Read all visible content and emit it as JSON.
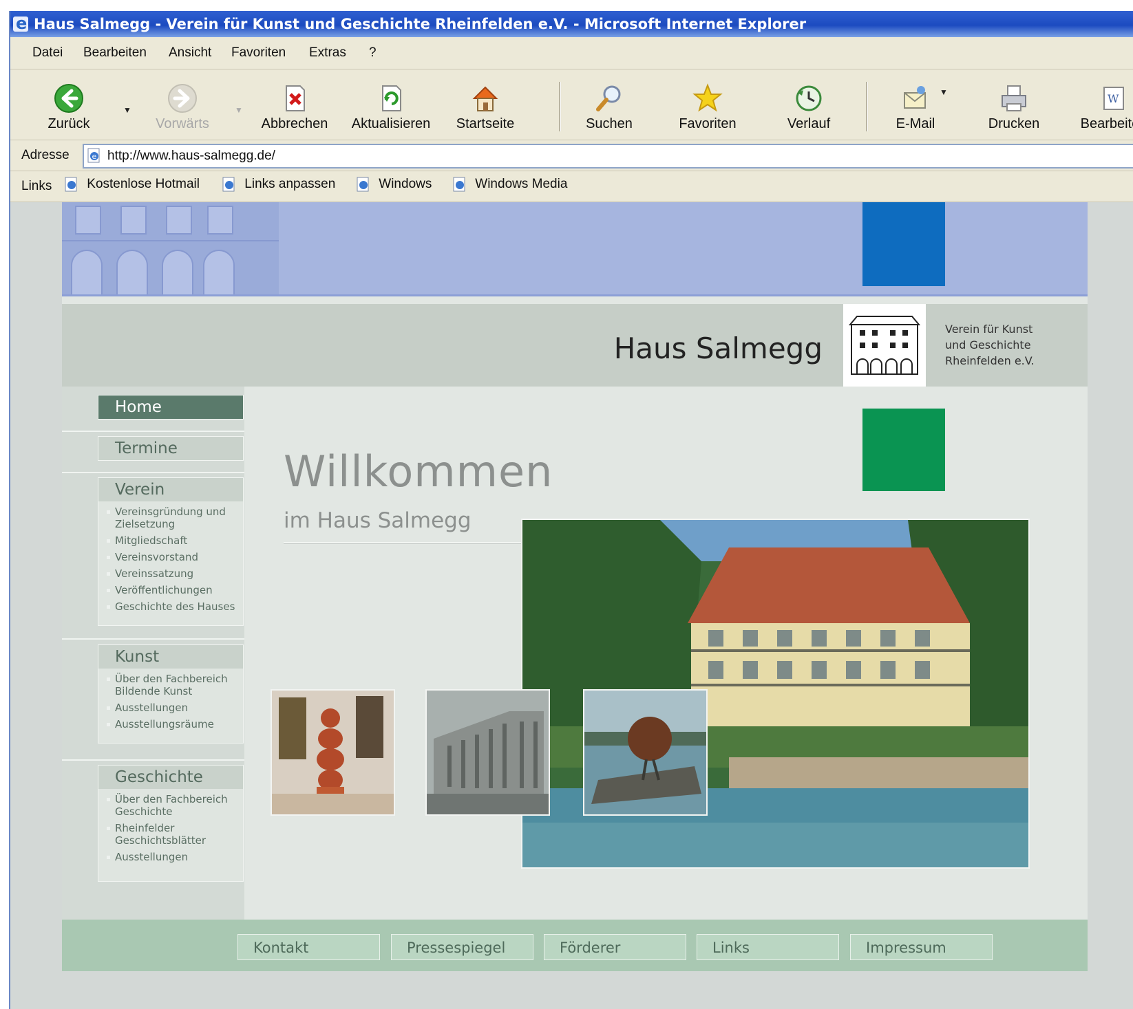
{
  "window": {
    "title": "Haus Salmegg - Verein für Kunst und Geschichte Rheinfelden e.V. - Microsoft Internet Explorer"
  },
  "menu": [
    "Datei",
    "Bearbeiten",
    "Ansicht",
    "Favoriten",
    "Extras",
    "?"
  ],
  "toolbar": {
    "back": "Zurück",
    "forward": "Vorwärts",
    "stop": "Abbrechen",
    "refresh": "Aktualisieren",
    "home": "Startseite",
    "search": "Suchen",
    "favorites": "Favoriten",
    "history": "Verlauf",
    "mail": "E-Mail",
    "print": "Drucken",
    "edit": "Bearbeiten"
  },
  "address": {
    "label": "Adresse",
    "url": "http://www.haus-salmegg.de/"
  },
  "links_bar": {
    "label": "Links",
    "items": [
      "Kostenlose Hotmail",
      "Links anpassen",
      "Windows",
      "Windows Media"
    ]
  },
  "site": {
    "title": "Haus Salmegg",
    "subtitle_lines": [
      "Verein für Kunst",
      "und Geschichte",
      "Rheinfelden e.V."
    ],
    "welcome": "Willkommen",
    "welcome_sub": "im Haus Salmegg",
    "nav": {
      "home": "Home",
      "termine": "Termine",
      "verein": {
        "label": "Verein",
        "items": [
          "Vereinsgründung und Zielsetzung",
          "Mitgliedschaft",
          "Vereinsvorstand",
          "Vereinssatzung",
          "Veröffentlichungen",
          "Geschichte des Hauses"
        ]
      },
      "kunst": {
        "label": "Kunst",
        "items": [
          "Über den Fachbereich Bildende Kunst",
          "Ausstellungen",
          "Ausstellungsräume"
        ]
      },
      "geschichte": {
        "label": "Geschichte",
        "items": [
          "Über den Fachbereich Geschichte",
          "Rheinfelder Geschichtsblätter",
          "Ausstellungen"
        ]
      }
    },
    "footer": [
      "Kontakt",
      "Pressespiegel",
      "Förderer",
      "Links",
      "Impressum"
    ]
  },
  "colors": {
    "blue_square": "#0e6cbf",
    "green_square": "#0a9452",
    "banner": "#a6b5df",
    "nav_active": "#5a7a6b"
  }
}
